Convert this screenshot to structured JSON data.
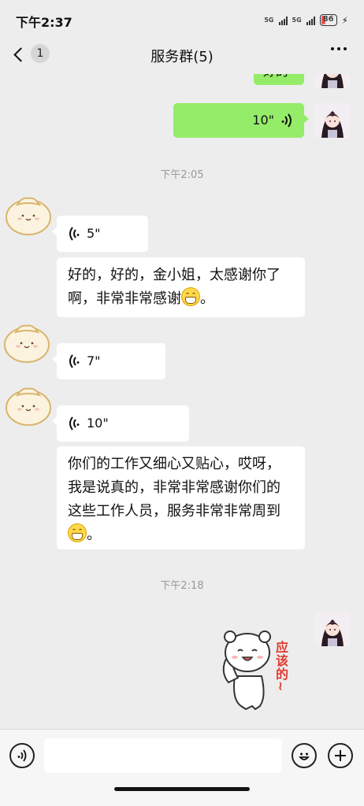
{
  "status_bar": {
    "time": "下午2:37",
    "network1": "5G",
    "network2": "5G",
    "battery": "86"
  },
  "nav": {
    "back_count": "1",
    "title": "服务群(5)"
  },
  "messages": {
    "partial_text": "好的",
    "voice_right_1": "10\"",
    "time_1": "下午2:05",
    "voice_left_1": "5\"",
    "text_left_1": "好的，好的，金小姐，太感谢你了啊，非常非常感谢",
    "voice_left_2": "7\"",
    "voice_left_3": "10\"",
    "text_left_2": "你们的工作又细心又贴心，哎呀，我是说真的，非常非常感谢你们的这些工作人员，服务非常非常周到",
    "time_2": "下午2:18",
    "sticker_caption": "应该的~"
  },
  "input": {
    "placeholder": ""
  },
  "colors": {
    "background": "#ededed",
    "bubble_self": "#95ec69",
    "bubble_other": "#ffffff"
  },
  "icons": [
    "back-chevron-icon",
    "more-icon",
    "voice-icon",
    "emoji-icon",
    "plus-icon",
    "grin-emoji-icon"
  ]
}
